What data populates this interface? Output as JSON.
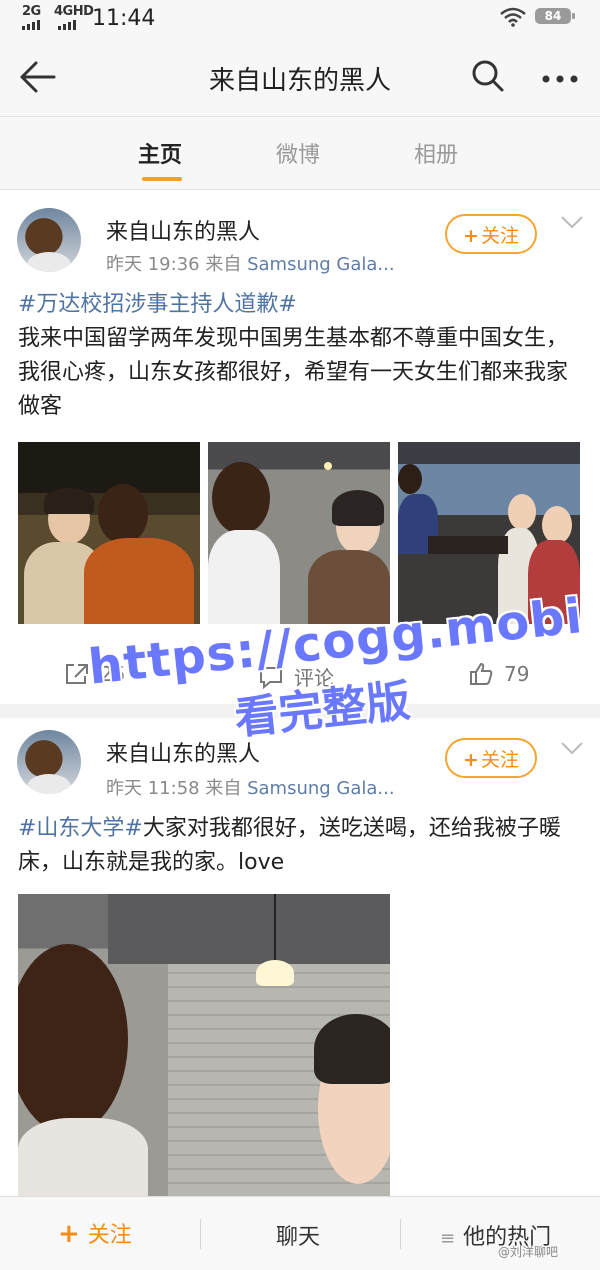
{
  "status_bar": {
    "signal1": "2G",
    "signal2": "4GHD",
    "time": "11:44",
    "battery": "84"
  },
  "nav": {
    "title": "来自山东的黑人"
  },
  "tabs": [
    {
      "label": "主页",
      "active": true
    },
    {
      "label": "微博",
      "active": false
    },
    {
      "label": "相册",
      "active": false
    }
  ],
  "posts": [
    {
      "author": "来自山东的黑人",
      "time": "昨天 19:36",
      "source_prefix": "来自",
      "source": "Samsung Gala...",
      "follow_label": "关注",
      "hashtag": "#万达校招涉事主持人道歉#",
      "text": "我来中国留学两年发现中国男生基本都不尊重中国女生，我很心疼，山东女孩都很好，希望有一天女生们都来我家做客",
      "repost_count": "25",
      "comment_label": "评论",
      "like_count": "79"
    },
    {
      "author": "来自山东的黑人",
      "time": "昨天 11:58",
      "source_prefix": "来自",
      "source": "Samsung Gala...",
      "follow_label": "关注",
      "hashtag": "#山东大学#",
      "text": "大家对我都很好，送吃送喝，还给我被子暖床，山东就是我的家。love"
    }
  ],
  "watermark": {
    "line1": "https://cogg.mobi",
    "line2": "看完整版"
  },
  "bottom_bar": {
    "follow": "关注",
    "chat": "聊天",
    "hot": "他的热门",
    "credit": "@刘洋聊吧"
  },
  "colors": {
    "accent": "#f5a020",
    "link": "#4f73a3",
    "watermark": "#6a78ff"
  }
}
